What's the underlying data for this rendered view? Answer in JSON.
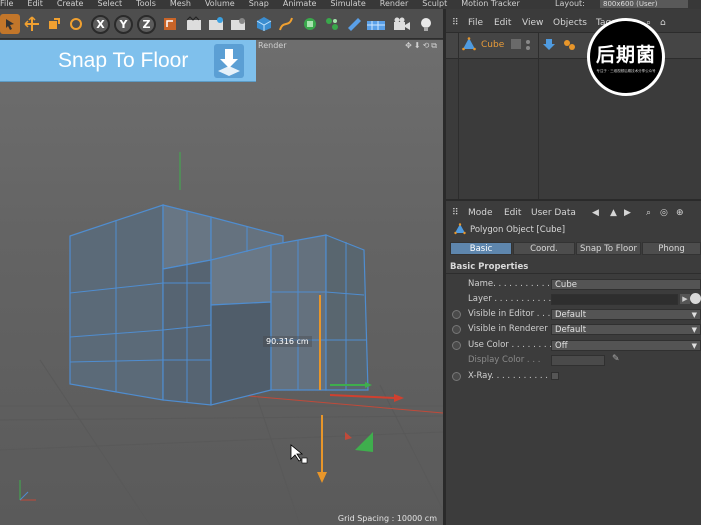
{
  "menubar": {
    "items": [
      "File",
      "Edit",
      "Create",
      "Select",
      "Tools",
      "Mesh",
      "Volume",
      "Snap",
      "Animate",
      "Simulate",
      "Render",
      "Sculpt",
      "Motion Tracker"
    ],
    "layout_label": "Layout:",
    "layout_value": "800x600 (User)"
  },
  "toolbar": {
    "axis_x": "X",
    "axis_y": "Y",
    "axis_z": "Z"
  },
  "viewport": {
    "header_render": "Render",
    "nav_icons": "✥⬇⟲⧉",
    "banner_title": "Snap To Floor",
    "measure_label": "90.316 cm",
    "grid_spacing": "Grid Spacing : 10000 cm"
  },
  "object_manager": {
    "menu": [
      "File",
      "Edit",
      "View",
      "Objects",
      "Tags"
    ],
    "object_name": "Cube"
  },
  "logo": {
    "text": "后期菌",
    "subtext": "专注于 · 三维视频后期技术分享公众号"
  },
  "attributes": {
    "menu": [
      "Mode",
      "Edit",
      "User Data"
    ],
    "title": "Polygon Object [Cube]",
    "tabs": [
      "Basic",
      "Coord.",
      "Snap To Floor",
      "Phong"
    ],
    "section": "Basic Properties",
    "props": [
      {
        "label": "Name. . . . . . . . . . . .",
        "value": "Cube"
      },
      {
        "label": "Layer . . . . . . . . . . . .",
        "value": ""
      },
      {
        "label": "Visible in Editor . . .",
        "value": "Default"
      },
      {
        "label": "Visible in Renderer",
        "value": "Default"
      },
      {
        "label": "Use Color . . . . . . . .",
        "value": "Off"
      },
      {
        "label": "Display Color . . .",
        "value": ""
      },
      {
        "label": "X-Ray. . . . . . . . . . . .",
        "value": ""
      }
    ]
  },
  "colors": {
    "accent_blue": "#5e86ad",
    "banner_blue": "#7fc0ec",
    "object_orange": "#e89b3a"
  }
}
